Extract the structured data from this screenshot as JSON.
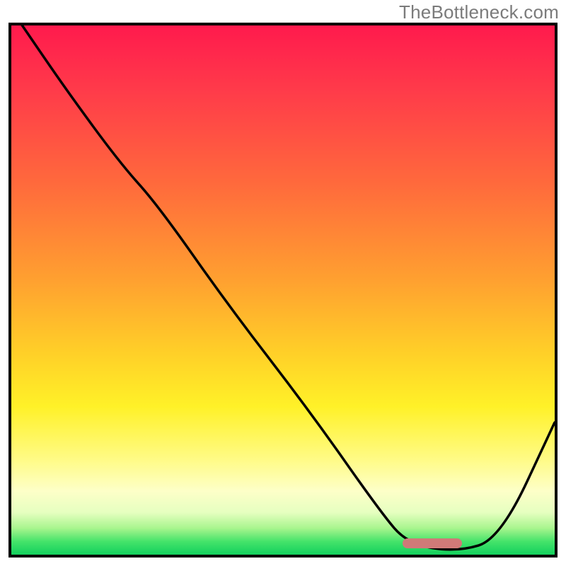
{
  "watermark": "TheBottleneck.com",
  "chart_data": {
    "type": "line",
    "title": "",
    "xlabel": "",
    "ylabel": "",
    "xlim": [
      0,
      100
    ],
    "ylim": [
      0,
      100
    ],
    "grid": false,
    "legend": false,
    "series": [
      {
        "name": "curve",
        "x": [
          2,
          10,
          20,
          27,
          40,
          55,
          68,
          73,
          82,
          90,
          100
        ],
        "y": [
          100,
          88,
          74,
          66,
          47,
          27,
          8,
          2,
          0.5,
          3,
          25
        ]
      }
    ],
    "marker": {
      "x_start": 72,
      "x_end": 83,
      "y": 2.2
    },
    "gradient_stops": [
      {
        "pos": 0,
        "color": "#ff1a4d"
      },
      {
        "pos": 0.3,
        "color": "#ff6a3c"
      },
      {
        "pos": 0.62,
        "color": "#ffd028"
      },
      {
        "pos": 0.88,
        "color": "#fdffc8"
      },
      {
        "pos": 1.0,
        "color": "#12d05d"
      }
    ]
  }
}
